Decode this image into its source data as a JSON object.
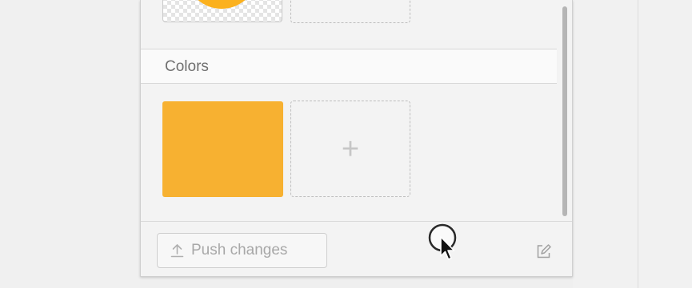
{
  "panel": {
    "colors_section": {
      "title": "Colors",
      "swatches": [
        {
          "color": "#F7B131"
        }
      ],
      "add_label": "+"
    },
    "images": {
      "thumbnail_color": "#FBB11E"
    },
    "footer": {
      "push_button_label": "Push changes",
      "push_icon": "upload-arrow-icon",
      "edit_icon": "edit-icon"
    }
  }
}
